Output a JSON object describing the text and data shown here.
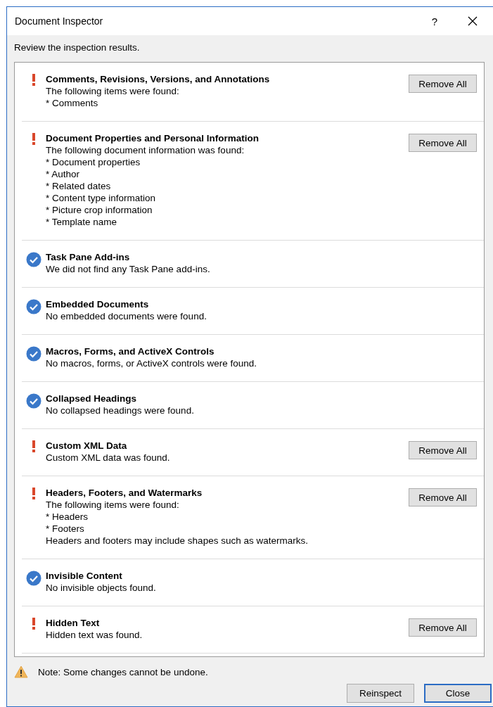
{
  "window": {
    "title": "Document Inspector",
    "help": "?"
  },
  "instruction": "Review the inspection results.",
  "sections": [
    {
      "kind": "found",
      "title": "Comments, Revisions, Versions, and Annotations",
      "lines": [
        "The following items were found:",
        "* Comments"
      ],
      "button": "Remove All"
    },
    {
      "kind": "found",
      "title": "Document Properties and Personal Information",
      "lines": [
        "The following document information was found:",
        "* Document properties",
        "* Author",
        "* Related dates",
        "* Content type information",
        "* Picture crop information",
        "* Template name"
      ],
      "button": "Remove All"
    },
    {
      "kind": "ok",
      "title": "Task Pane Add-ins",
      "lines": [
        "We did not find any Task Pane add-ins."
      ]
    },
    {
      "kind": "ok",
      "title": "Embedded Documents",
      "lines": [
        "No embedded documents were found."
      ]
    },
    {
      "kind": "ok",
      "title": "Macros, Forms, and ActiveX Controls",
      "lines": [
        "No macros, forms, or ActiveX controls were found."
      ]
    },
    {
      "kind": "ok",
      "title": "Collapsed Headings",
      "lines": [
        "No collapsed headings were found."
      ]
    },
    {
      "kind": "found",
      "title": "Custom XML Data",
      "lines": [
        "Custom XML data was found."
      ],
      "button": "Remove All"
    },
    {
      "kind": "found",
      "title": "Headers, Footers, and Watermarks",
      "lines": [
        "The following items were found:",
        "* Headers",
        "* Footers",
        "Headers and footers may include shapes such as watermarks."
      ],
      "button": "Remove All"
    },
    {
      "kind": "ok",
      "title": "Invisible Content",
      "lines": [
        "No invisible objects found."
      ]
    },
    {
      "kind": "found",
      "title": "Hidden Text",
      "lines": [
        "Hidden text was found."
      ],
      "button": "Remove All"
    }
  ],
  "note": "Note: Some changes cannot be undone.",
  "buttons": [
    {
      "label": "Reinspect",
      "default": false
    },
    {
      "label": "Close",
      "default": true
    }
  ]
}
